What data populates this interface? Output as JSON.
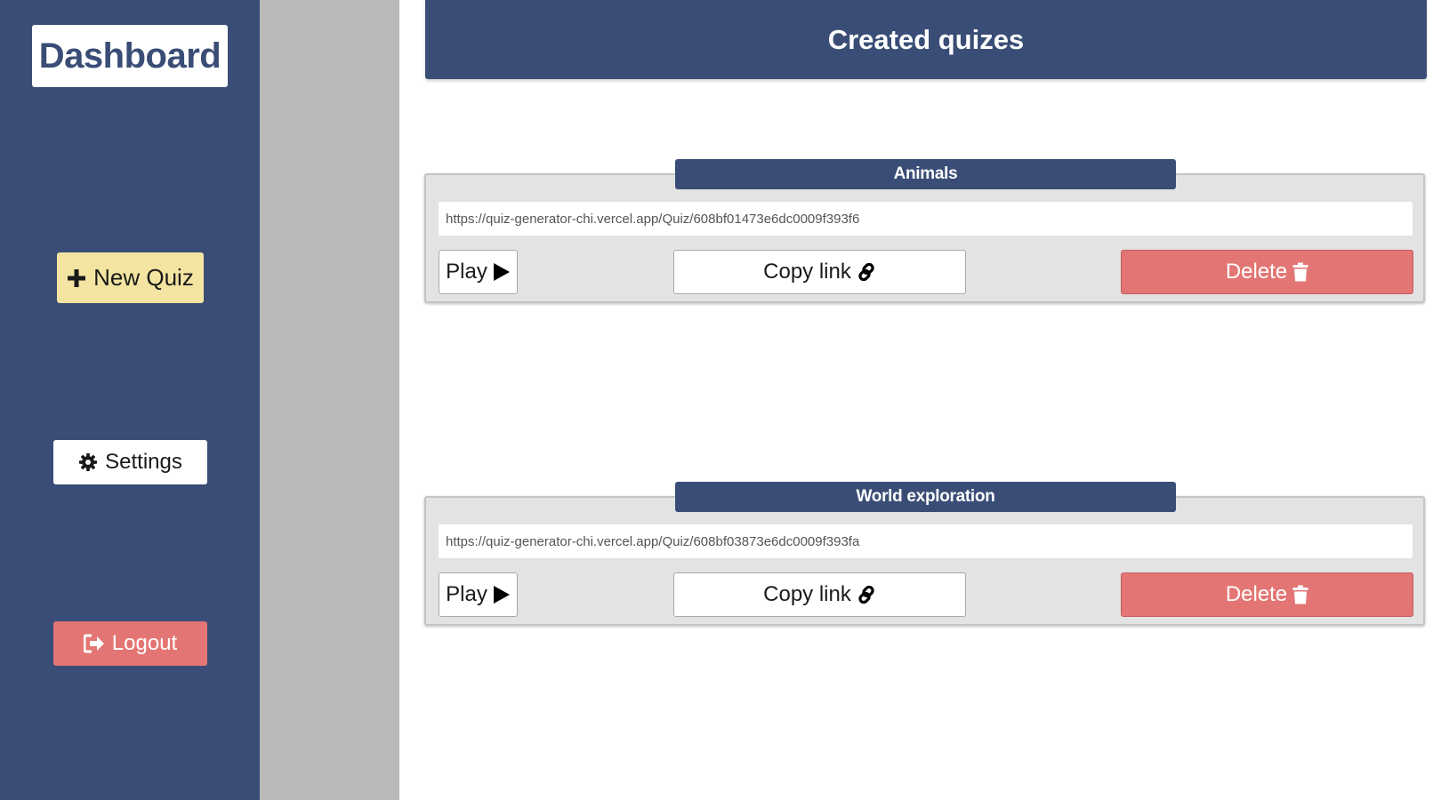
{
  "sidebar": {
    "logo": "Dashboard",
    "new_quiz": "New Quiz",
    "settings": "Settings",
    "logout": "Logout",
    "new_quiz_icon": "plus-icon",
    "settings_icon": "gear-icon",
    "logout_icon": "sign-out-icon"
  },
  "header": {
    "title": "Created quizes"
  },
  "quizzes": [
    {
      "title": "Animals",
      "url": "https://quiz-generator-chi.vercel.app/Quiz/608bf01473e6dc0009f393f6",
      "play": "Play",
      "copy": "Copy link",
      "delete": "Delete"
    },
    {
      "title": "World exploration",
      "url": "https://quiz-generator-chi.vercel.app/Quiz/608bf03873e6dc0009f393fa",
      "play": "Play",
      "copy": "Copy link",
      "delete": "Delete"
    }
  ],
  "colors": {
    "primary": "#3a4d76",
    "new_quiz": "#f4e4a1",
    "danger": "#e37674",
    "card_bg": "#e3e3e3",
    "gutter": "#b9b9b9"
  }
}
